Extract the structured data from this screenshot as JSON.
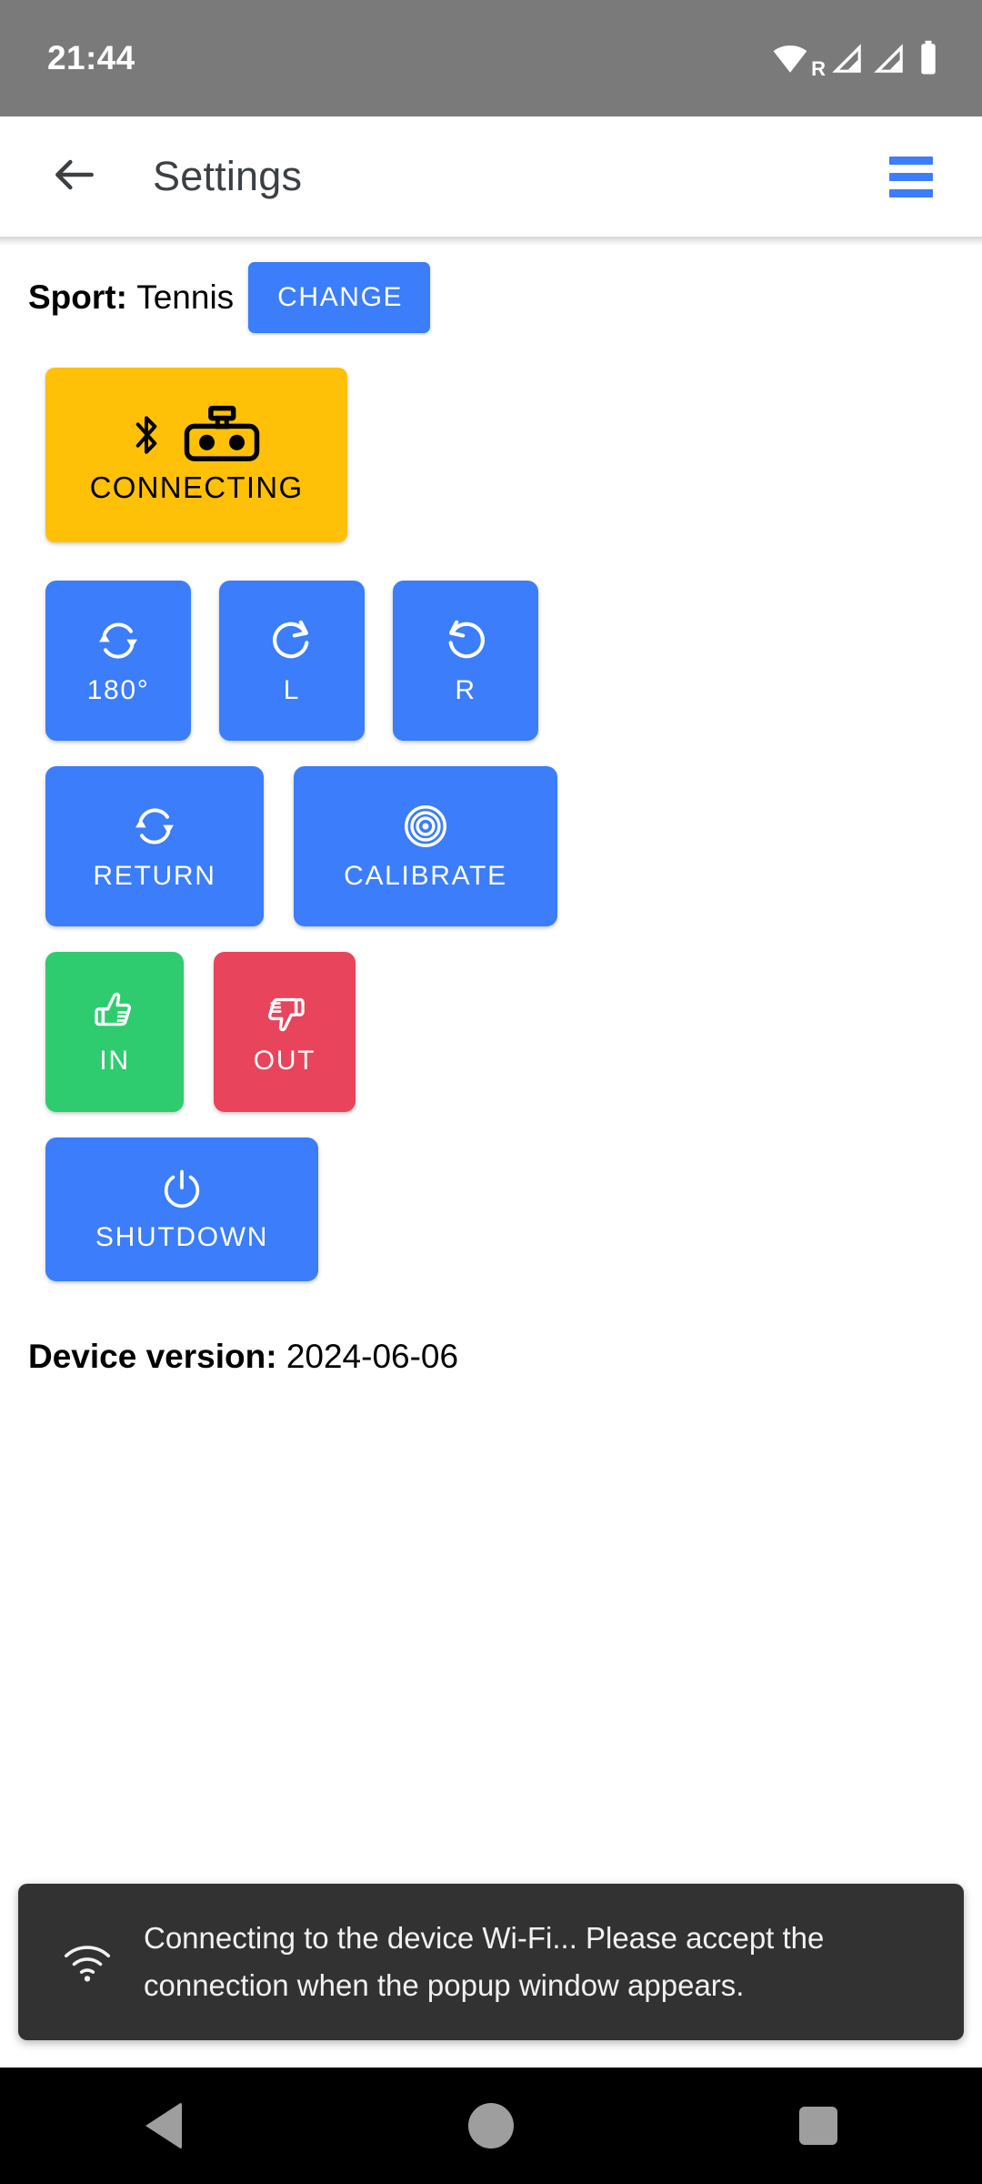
{
  "status_bar": {
    "clock": "21:44",
    "icons": [
      "wifi-icon",
      "roaming-indicator",
      "signal-bars-icon",
      "signal-bars-icon",
      "battery-icon"
    ],
    "roaming_label": "R",
    "background_color": "#7a7a7a"
  },
  "app_bar": {
    "back_icon": "arrow-back-icon",
    "title": "Settings",
    "menu_icon": "hamburger-menu-icon",
    "menu_color": "#3b7dfa"
  },
  "sport": {
    "label": "Sport:",
    "value": "Tennis",
    "change_label": "CHANGE"
  },
  "connection": {
    "status_label": "CONNECTING",
    "color": "#ffc107",
    "icons": [
      "bluetooth-icon",
      "remote-control-icon"
    ]
  },
  "controls": [
    {
      "label": "180°",
      "icon": "sync-swap-icon",
      "color": "#3b7dfa"
    },
    {
      "label": "L",
      "icon": "rotate-clockwise-icon",
      "color": "#3b7dfa"
    },
    {
      "label": "R",
      "icon": "rotate-counterclockwise-icon",
      "color": "#3b7dfa"
    },
    {
      "label": "RETURN",
      "icon": "sync-swap-icon",
      "color": "#3b7dfa"
    },
    {
      "label": "CALIBRATE",
      "icon": "target-rings-icon",
      "color": "#3b7dfa"
    },
    {
      "label": "IN",
      "icon": "thumb-up-icon",
      "color": "#2ecc6f"
    },
    {
      "label": "OUT",
      "icon": "thumb-down-icon",
      "color": "#e8445c"
    },
    {
      "label": "SHUTDOWN",
      "icon": "power-icon",
      "color": "#3b7dfa"
    }
  ],
  "device": {
    "version_label": "Device version:",
    "version_value": "2024-06-06"
  },
  "snackbar": {
    "icon": "wifi-icon",
    "message": "Connecting to the device Wi-Fi... Please accept the connection when the popup window appears.",
    "background_color": "#323232"
  },
  "nav_bar": {
    "back": "nav-back-icon",
    "home": "nav-home-icon",
    "recents": "nav-recents-icon"
  }
}
